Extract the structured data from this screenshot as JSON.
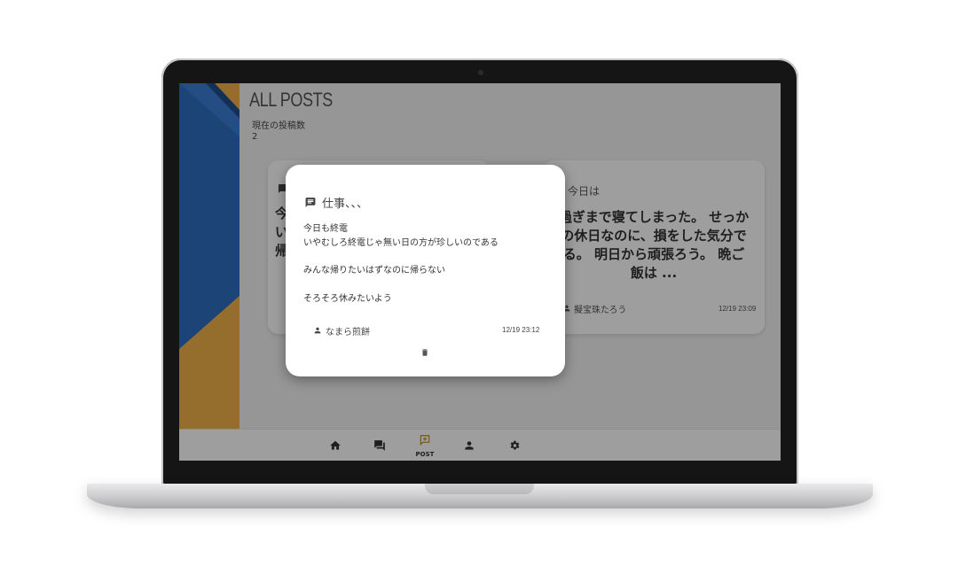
{
  "page": {
    "title": "ALL POSTS",
    "count_label": "現在の投稿数",
    "count_value": "2"
  },
  "cards": [
    {
      "title": "",
      "body_lines": [
        "今",
        "い",
        "帰"
      ],
      "author": "",
      "date": ""
    },
    {
      "title": "今日は",
      "body_lines": [
        "過ぎまで寝てしまった。 せっか",
        "の休日なのに、損をした気分で",
        "る。 明日から頑張ろう。 晩ご",
        "飯は ..."
      ],
      "author": "擬宝珠たろう",
      "date": "12/19 23:09"
    }
  ],
  "nav": {
    "items": [
      {
        "name": "home",
        "icon": "home-icon"
      },
      {
        "name": "posts",
        "icon": "forum-icon"
      },
      {
        "name": "post",
        "icon": "post-add-icon",
        "label": "POST"
      },
      {
        "name": "user",
        "icon": "person-icon"
      },
      {
        "name": "settings",
        "icon": "gear-icon"
      }
    ]
  },
  "modal": {
    "title": "仕事、、、",
    "lines": [
      "今日も終電",
      "いやむしろ終電じゃ無い日の方が珍しいのである",
      "みんな帰りたいはずなのに帰らない",
      "そろそろ休みたいよう"
    ],
    "author": "なまら煎餅",
    "date": "12/19 23:12",
    "delete_icon": "trash-icon"
  },
  "colors": {
    "accent": "#f0b24a",
    "blue": "#2f6fc0"
  }
}
